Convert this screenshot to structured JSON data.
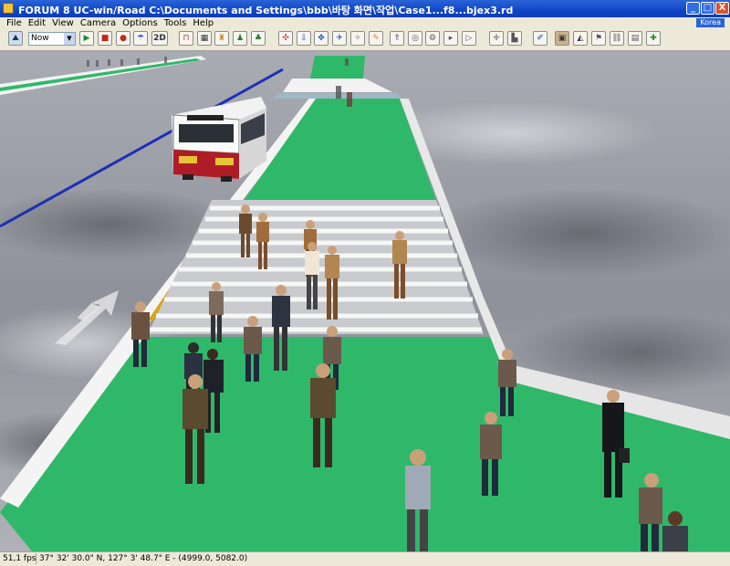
{
  "window": {
    "title": "FORUM 8    UC-win/Road    C:\\Documents and Settings\\bbb\\바탕 화면\\작업\\Case1...f8...bjex3.rd",
    "minimize_label": "_",
    "maximize_label": "□",
    "close_label": "X"
  },
  "menu": {
    "items": [
      "File",
      "Edit",
      "View",
      "Camera",
      "Options",
      "Tools",
      "Help"
    ]
  },
  "language_indicator": "Korea",
  "toolbar": {
    "time_select_value": "Now",
    "zoom_2d_label": "2D",
    "buttons": [
      {
        "name": "terrain",
        "icon": "terrain-icon"
      },
      {
        "name": "play",
        "icon": "play-icon"
      },
      {
        "name": "build",
        "icon": "building-icon"
      },
      {
        "name": "signal",
        "icon": "traffic-signal-icon"
      },
      {
        "name": "weather",
        "icon": "weather-icon"
      },
      {
        "name": "road-edit",
        "icon": "road-icon"
      },
      {
        "name": "table",
        "icon": "table-icon"
      },
      {
        "name": "model",
        "icon": "model-icon"
      },
      {
        "name": "people",
        "icon": "people-icon"
      },
      {
        "name": "trees",
        "icon": "tree-icon"
      },
      {
        "name": "rotate",
        "icon": "rotate-icon"
      },
      {
        "name": "down",
        "icon": "arrow-down-icon"
      },
      {
        "name": "move",
        "icon": "move-icon"
      },
      {
        "name": "fly",
        "icon": "airplane-icon"
      },
      {
        "name": "pan",
        "icon": "pan-icon"
      },
      {
        "name": "pencil",
        "icon": "pencil-icon"
      },
      {
        "name": "walk",
        "icon": "walk-icon"
      },
      {
        "name": "steer",
        "icon": "steering-icon"
      },
      {
        "name": "gear",
        "icon": "gear-icon"
      },
      {
        "name": "camera-a",
        "icon": "camera-icon"
      },
      {
        "name": "camera-b",
        "icon": "camera-icon"
      },
      {
        "name": "center",
        "icon": "center-icon"
      },
      {
        "name": "chart",
        "icon": "chart-icon"
      },
      {
        "name": "draw",
        "icon": "draw-icon"
      },
      {
        "name": "map",
        "icon": "map-icon"
      },
      {
        "name": "tunnel",
        "icon": "tunnel-icon"
      },
      {
        "name": "sign",
        "icon": "sign-icon"
      },
      {
        "name": "link",
        "icon": "link-icon"
      },
      {
        "name": "doc",
        "icon": "document-icon"
      },
      {
        "name": "add",
        "icon": "add-icon"
      }
    ]
  },
  "status": {
    "fps": "51,1 fps",
    "coordinates": "37° 32' 30.0\" N, 127° 3' 48.7\" E  -  (4999.0, 5082.0)"
  },
  "colors": {
    "sidewalk_green": "#2fb86a",
    "road_gray": "#8a8e96",
    "curb_white": "#f4f4f4",
    "bus_body": "#f2f2f2",
    "bus_red": "#b01c26",
    "lane_blue": "#1e2fb5",
    "lane_yellow": "#d9a41a"
  }
}
